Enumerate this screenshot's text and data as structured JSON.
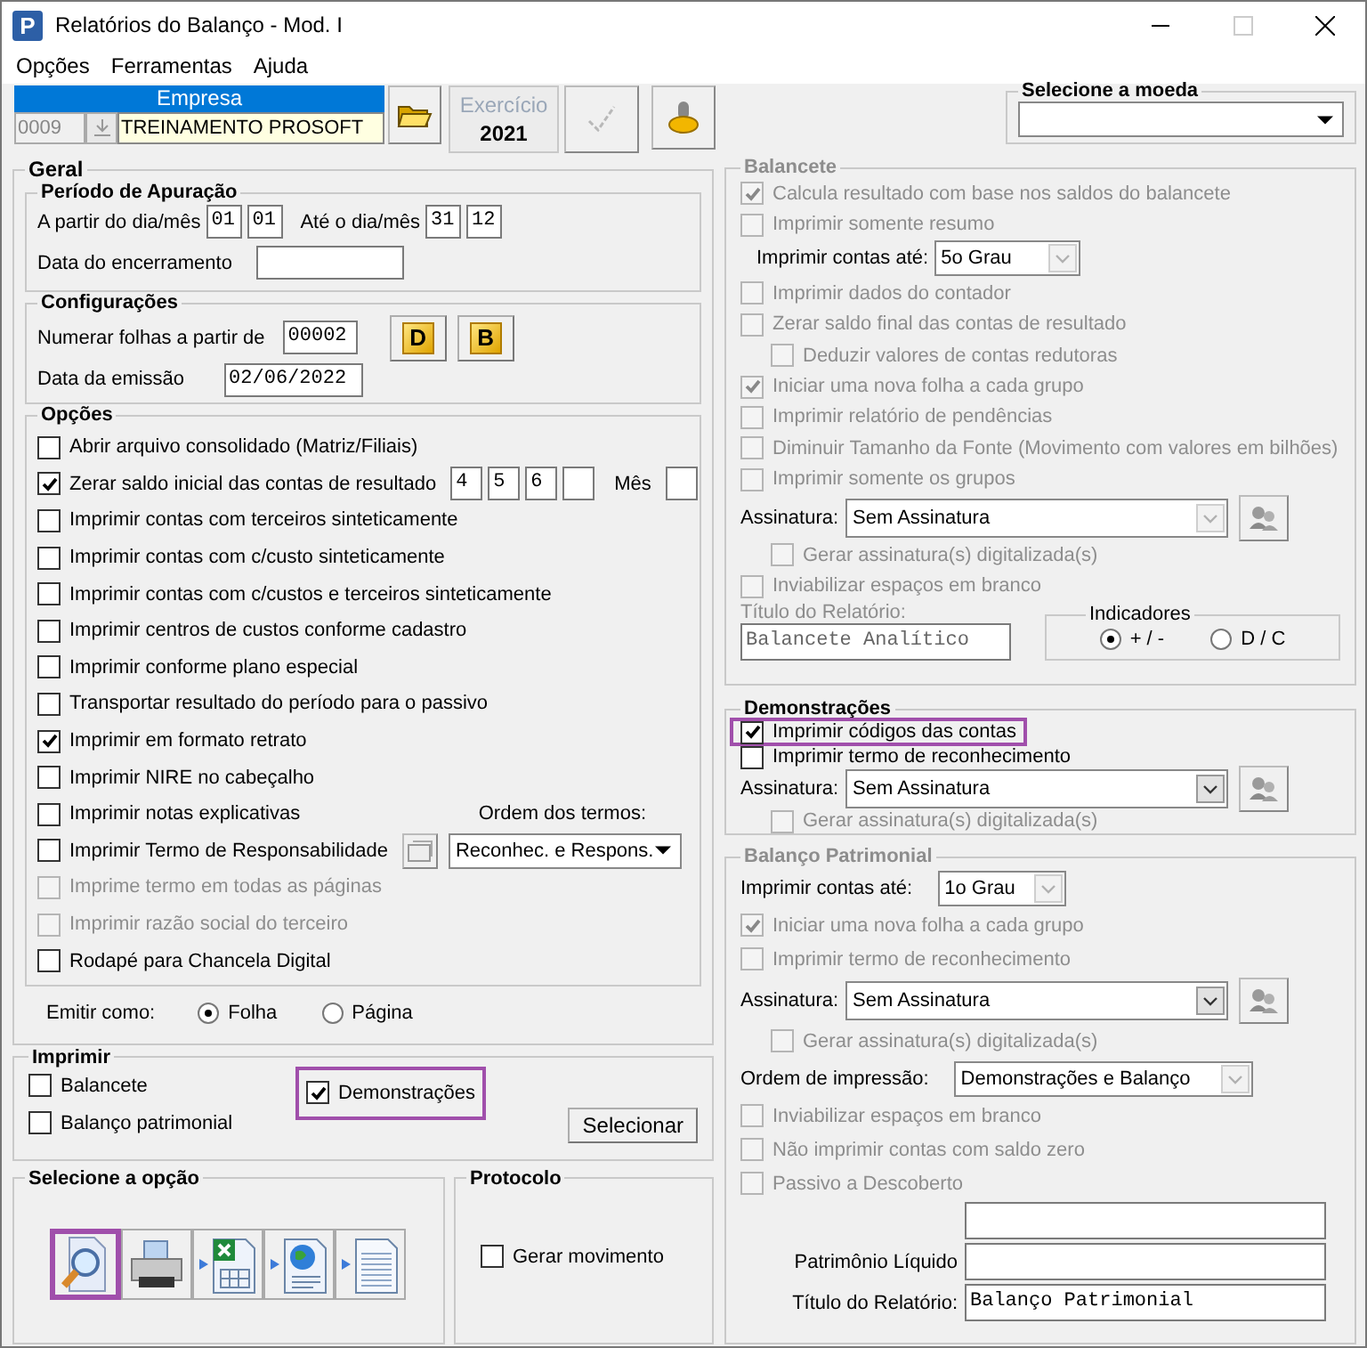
{
  "window": {
    "icon_letter": "P",
    "title": "Relatórios do Balanço - Mod. I"
  },
  "menu": [
    "Opções",
    "Ferramentas",
    "Ajuda"
  ],
  "toolbar": {
    "empresa": {
      "label": "Empresa",
      "code": "0009",
      "name": "TREINAMENTO PROSOFT"
    },
    "exercicio": {
      "label": "Exercício",
      "year": "2021"
    },
    "moeda": {
      "title": "Selecione a moeda"
    }
  },
  "geral": {
    "title": "Geral",
    "periodo": {
      "title": "Período de Apuração",
      "from_label": "A partir do dia/mês",
      "from_day": "01",
      "from_month": "01",
      "to_label": "Até o dia/mês",
      "to_day": "31",
      "to_month": "12",
      "closing_label": "Data do encerramento"
    },
    "config": {
      "title": "Configurações",
      "pages_label": "Numerar folhas a partir de",
      "pages_value": "00002",
      "buttons": [
        "D",
        "B"
      ],
      "date_label": "Data da emissão",
      "date_value": "02/06/2022"
    },
    "opcoes": {
      "title": "Opções",
      "items": [
        {
          "kind": "check",
          "label": "Abrir arquivo consolidado (Matriz/Filiais)",
          "checked": false,
          "disabled": false
        },
        {
          "kind": "check_fields",
          "label": "Zerar saldo inicial das contas de resultado",
          "checked": true,
          "disabled": false,
          "fields": [
            "4",
            "5",
            "6"
          ],
          "month_label": "Mês"
        },
        {
          "kind": "check",
          "label": "Imprimir contas com terceiros sinteticamente",
          "checked": false,
          "disabled": false
        },
        {
          "kind": "check",
          "label": "Imprimir contas com c/custo sinteticamente",
          "checked": false,
          "disabled": false
        },
        {
          "kind": "check",
          "label": "Imprimir contas com c/custos e terceiros sinteticamente",
          "checked": false,
          "disabled": false
        },
        {
          "kind": "check",
          "label": "Imprimir centros de custos conforme cadastro",
          "checked": false,
          "disabled": false
        },
        {
          "kind": "check",
          "label": "Imprimir conforme plano especial",
          "checked": false,
          "disabled": false
        },
        {
          "kind": "check",
          "label": "Transportar resultado do período para o passivo",
          "checked": false,
          "disabled": false
        },
        {
          "kind": "check",
          "label": "Imprimir em formato retrato",
          "checked": true,
          "disabled": false
        },
        {
          "kind": "check",
          "label": "Imprimir NIRE no cabeçalho",
          "checked": false,
          "disabled": false
        },
        {
          "kind": "check",
          "label": "Imprimir notas explicativas",
          "checked": false,
          "disabled": false,
          "aside": "Ordem dos termos:"
        },
        {
          "kind": "check_termo",
          "label": "Imprimir Termo de Responsabilidade",
          "checked": false,
          "disabled": false,
          "select": "Reconhec. e Respons."
        },
        {
          "kind": "check",
          "label": "Imprime termo em todas as páginas",
          "checked": false,
          "disabled": true
        },
        {
          "kind": "check",
          "label": "Imprimir razão social do terceiro",
          "checked": false,
          "disabled": true
        },
        {
          "kind": "check",
          "label": "Rodapé para Chancela Digital",
          "checked": false,
          "disabled": false
        }
      ]
    },
    "emitir": {
      "label": "Emitir como:",
      "options": [
        {
          "label": "Folha",
          "selected": true
        },
        {
          "label": "Página",
          "selected": false
        }
      ]
    }
  },
  "imprimir": {
    "title": "Imprimir",
    "items": [
      {
        "label": "Balancete",
        "checked": false,
        "highlighted": false
      },
      {
        "label": "Balanço patrimonial",
        "checked": false,
        "highlighted": false
      },
      {
        "label": "Demonstrações",
        "checked": true,
        "highlighted": true
      }
    ],
    "button": "Selecionar"
  },
  "selecione": {
    "title": "Selecione a opção",
    "options": [
      {
        "kind": "preview",
        "highlighted": true
      },
      {
        "kind": "print",
        "highlighted": false
      },
      {
        "kind": "excel",
        "highlighted": false
      },
      {
        "kind": "web",
        "highlighted": false
      },
      {
        "kind": "text",
        "highlighted": false
      }
    ]
  },
  "protocolo": {
    "title": "Protocolo",
    "check": {
      "label": "Gerar movimento",
      "checked": false
    }
  },
  "balancete": {
    "title": "Balancete",
    "disabled": true,
    "items": [
      {
        "kind": "check",
        "label": "Calcula resultado com base nos saldos do balancete",
        "checked": true,
        "disabled": true
      },
      {
        "kind": "check",
        "label": "Imprimir somente resumo",
        "checked": false,
        "disabled": true
      },
      {
        "kind": "select",
        "label": "Imprimir contas até:",
        "value": "5o Grau",
        "disabled": true
      },
      {
        "kind": "check",
        "label": "Imprimir dados do contador",
        "checked": false,
        "disabled": true
      },
      {
        "kind": "check",
        "label": "Zerar saldo final das contas de resultado",
        "checked": false,
        "disabled": true,
        "children": [
          {
            "kind": "check",
            "label": "Deduzir valores de contas redutoras",
            "checked": false,
            "disabled": true
          }
        ]
      },
      {
        "kind": "check",
        "label": "Iniciar uma nova folha a cada grupo",
        "checked": true,
        "disabled": true
      },
      {
        "kind": "check",
        "label": "Imprimir relatório de pendências",
        "checked": false,
        "disabled": true
      },
      {
        "kind": "check",
        "label": "Diminuir Tamanho da Fonte (Movimento com valores em bilhões)",
        "checked": false,
        "disabled": true
      },
      {
        "kind": "check",
        "label": "Imprimir somente os grupos",
        "checked": false,
        "disabled": true
      },
      {
        "kind": "signature",
        "label": "Assinatura:",
        "value": "Sem Assinatura",
        "disabled": true,
        "children": [
          {
            "kind": "check",
            "label": "Gerar assinatura(s) digitalizada(s)",
            "checked": false,
            "disabled": true
          }
        ]
      },
      {
        "kind": "check",
        "label": "Inviabilizar espaços em branco",
        "checked": false,
        "disabled": true
      }
    ],
    "report_title": {
      "label": "Título do Relatório:",
      "value": "Balancete Analítico"
    },
    "indicadores": {
      "title": "Indicadores",
      "options": [
        {
          "label": "+ / -",
          "selected": true
        },
        {
          "label": "D / C",
          "selected": false
        }
      ]
    }
  },
  "demonstracoes": {
    "title": "Demonstrações",
    "disabled": false,
    "items": [
      {
        "kind": "check",
        "label": "Imprimir códigos das contas",
        "checked": true,
        "disabled": false,
        "highlighted": true
      },
      {
        "kind": "check",
        "label": "Imprimir termo de reconhecimento",
        "checked": false,
        "disabled": false,
        "highlighted": false
      },
      {
        "kind": "signature",
        "label": "Assinatura:",
        "value": "Sem Assinatura",
        "disabled": false,
        "children": [
          {
            "kind": "check",
            "label": "Gerar assinatura(s) digitalizada(s)",
            "checked": false,
            "disabled": true
          }
        ]
      }
    ]
  },
  "balanco": {
    "title": "Balanço Patrimonial",
    "disabled": true,
    "items": [
      {
        "kind": "select",
        "label": "Imprimir contas até:",
        "value": "1o Grau",
        "disabled": true
      },
      {
        "kind": "check",
        "label": "Iniciar uma nova folha a cada grupo",
        "checked": true,
        "disabled": true
      },
      {
        "kind": "check",
        "label": "Imprimir termo de reconhecimento",
        "checked": false,
        "disabled": true
      },
      {
        "kind": "signature",
        "label": "Assinatura:",
        "value": "Sem Assinatura",
        "disabled": false,
        "children": [
          {
            "kind": "check",
            "label": "Gerar assinatura(s) digitalizada(s)",
            "checked": false,
            "disabled": true
          }
        ]
      },
      {
        "kind": "select",
        "label": "Ordem de impressão:",
        "value": "Demonstrações e Balanço",
        "disabled": true
      },
      {
        "kind": "check",
        "label": "Inviabilizar espaços em branco",
        "checked": false,
        "disabled": true
      },
      {
        "kind": "check",
        "label": "Não imprimir contas com saldo zero",
        "checked": false,
        "disabled": true
      },
      {
        "kind": "check",
        "label": "Passivo a Descoberto",
        "checked": false,
        "disabled": true
      },
      {
        "kind": "field"
      },
      {
        "kind": "field",
        "label": "Patrimônio Líquido"
      },
      {
        "kind": "field",
        "label": "Título do Relatório:",
        "value": "Balanço Patrimonial"
      }
    ]
  }
}
